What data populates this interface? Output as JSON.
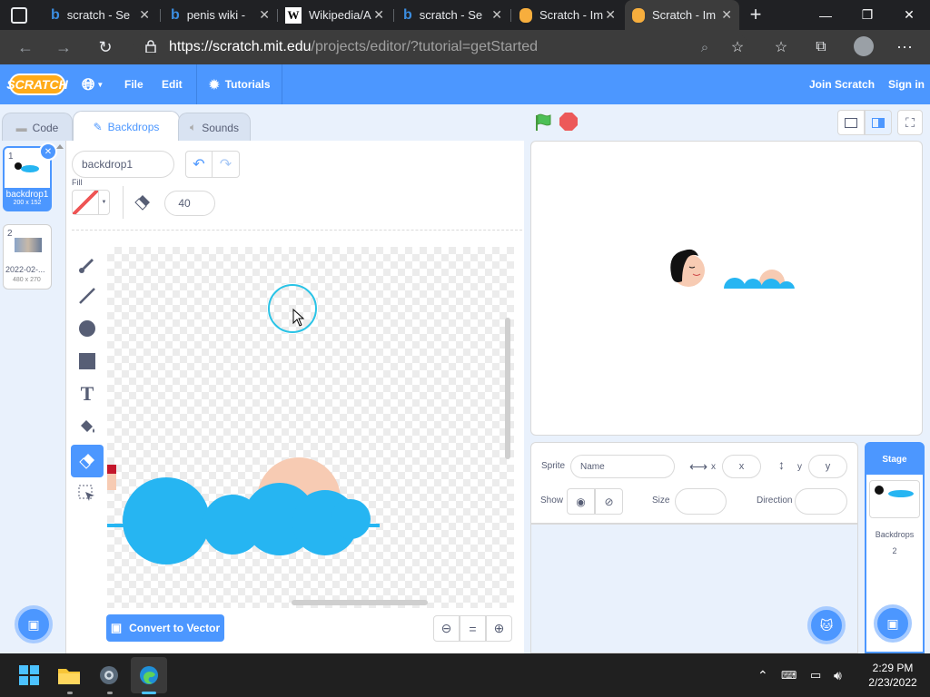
{
  "browser": {
    "tabs": [
      {
        "icon": "bing-icon",
        "label": "scratch - Se"
      },
      {
        "icon": "bing-icon",
        "label": "penis wiki -"
      },
      {
        "icon": "wikipedia-icon",
        "label": "Wikipedia/A"
      },
      {
        "icon": "bing-icon",
        "label": "scratch - Se"
      },
      {
        "icon": "scratch-icon",
        "label": "Scratch - Im"
      },
      {
        "icon": "scratch-icon",
        "label": "Scratch - Im"
      }
    ],
    "url_host": "https://scratch.mit.edu",
    "url_path": "/projects/editor/?tutorial=getStarted"
  },
  "menubar": {
    "logo": "SCRATCH",
    "file": "File",
    "edit": "Edit",
    "tutorials": "Tutorials",
    "join": "Join Scratch",
    "signin": "Sign in"
  },
  "editor_tabs": {
    "code": "Code",
    "backdrops": "Backdrops",
    "sounds": "Sounds"
  },
  "costumes": [
    {
      "index": "1",
      "name": "backdrop1",
      "size": "200 x 152"
    },
    {
      "index": "2",
      "name": "2022-02-...",
      "size": "480 x 270"
    }
  ],
  "paint": {
    "costume_name": "backdrop1",
    "fill_label": "Fill",
    "eraser_size": "40",
    "convert_label": "Convert to Vector",
    "zoom_reset": "="
  },
  "sprite_info": {
    "sprite_label": "Sprite",
    "name_placeholder": "Name",
    "x_label": "x",
    "x_placeholder": "x",
    "y_label": "y",
    "y_placeholder": "y",
    "show_label": "Show",
    "size_label": "Size",
    "direction_label": "Direction"
  },
  "stage_panel": {
    "title": "Stage",
    "backdrops_label": "Backdrops",
    "backdrops_count": "2"
  },
  "taskbar": {
    "time": "2:29 PM",
    "date": "2/23/2022"
  },
  "colors": {
    "scratch_blue": "#4c97ff",
    "figure_blue": "#26b5f2",
    "figure_skin": "#f7cbb3",
    "green_flag": "#4cbf56",
    "stop_red": "#ec5959"
  }
}
